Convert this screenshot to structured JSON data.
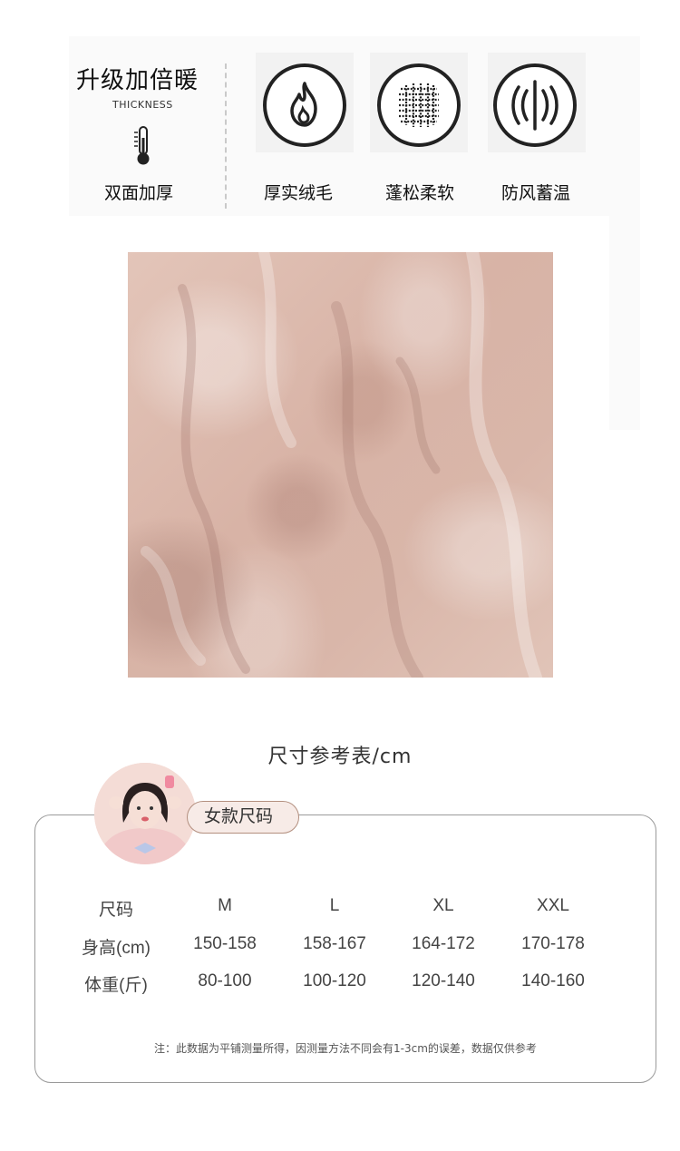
{
  "banner": {
    "title": "升级加倍暖",
    "subtitle_en": "THICKNESS",
    "double_label": "双面加厚",
    "features": [
      {
        "icon": "flame-icon",
        "label": "厚实绒毛"
      },
      {
        "icon": "woven-grid-icon",
        "label": "蓬松柔软"
      },
      {
        "icon": "windproof-icon",
        "label": "防风蓄温"
      }
    ]
  },
  "size_chart": {
    "title": "尺寸参考表/cm",
    "category": "女款尺码",
    "header": [
      "尺码",
      "M",
      "L",
      "XL",
      "XXL"
    ],
    "rows": [
      [
        "身高(cm)",
        "150-158",
        "158-167",
        "164-172",
        "170-178"
      ],
      [
        "体重(斤)",
        "80-100",
        "100-120",
        "120-140",
        "140-160"
      ]
    ],
    "note": "注：此数据为平铺测量所得，因测量方法不同会有1-3cm的误差，数据仅供参考"
  }
}
